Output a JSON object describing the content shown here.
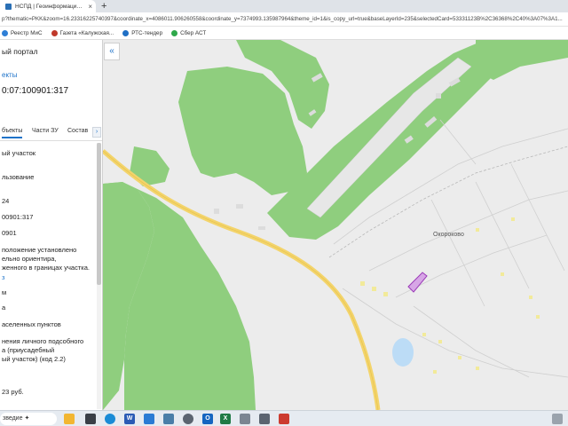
{
  "browser": {
    "tab_title": "НСПД | Геоинформационный",
    "tab_close": "×",
    "new_tab": "+",
    "url": "p?thematic=PKK&zoom=16.23316225740397&coordinate_x=4086011.906260558&coordinate_y=7374993.135987964&theme_id=1&is_copy_url=true&baseLayerId=235&selectedCard=53331123B%2C36368%2C40%3A07%3A1...",
    "bookmarks": [
      {
        "label": "Реестр МиС",
        "color": "#2f7fd6"
      },
      {
        "label": "Газета «Калужская...",
        "color": "#c0392b"
      },
      {
        "label": "РТС-тендер",
        "color": "#1f6fc5"
      },
      {
        "label": "Сбер АСТ",
        "color": "#2ea84a"
      }
    ]
  },
  "panel": {
    "portal_title": "ый портал",
    "objects_link": "екты",
    "cad_number": "0:07:100901:317",
    "tabs": [
      "бъекты",
      "Части ЗУ",
      "Состав"
    ],
    "tabs_next": "›",
    "info_lines": [
      "ый участок",
      "льзование",
      "24",
      "00901:317",
      "0901",
      "положение установлено",
      "ельно ориентира,",
      "женного в границах участка.",
      "з",
      "м",
      "а",
      "аселенных пунктов",
      "нения личного подсобного",
      "а (приусадебный",
      "ый участок) (код 2.2)",
      "23 руб."
    ]
  },
  "collapse_button": "«",
  "map": {
    "village_label": "Окороково"
  },
  "taskbar": {
    "search_text": "зведие",
    "apps": [
      {
        "name": "files",
        "label": "",
        "color": "#f2b632"
      },
      {
        "name": "edge",
        "label": "",
        "color": "#1a8bd6"
      },
      {
        "name": "word",
        "label": "W",
        "color": "#2b5bb5"
      },
      {
        "name": "mail",
        "label": "",
        "color": "#2a7bd4"
      },
      {
        "name": "chrome",
        "label": "",
        "color": "#4a7ea8"
      },
      {
        "name": "outlook",
        "label": "O",
        "color": "#1565c0"
      },
      {
        "name": "excel",
        "label": "X",
        "color": "#1f7a45"
      },
      {
        "name": "app1",
        "label": "",
        "color": "#5b6470"
      },
      {
        "name": "app2",
        "label": "",
        "color": "#7b8591"
      },
      {
        "name": "app3",
        "label": "",
        "color": "#cc3b30"
      }
    ]
  }
}
